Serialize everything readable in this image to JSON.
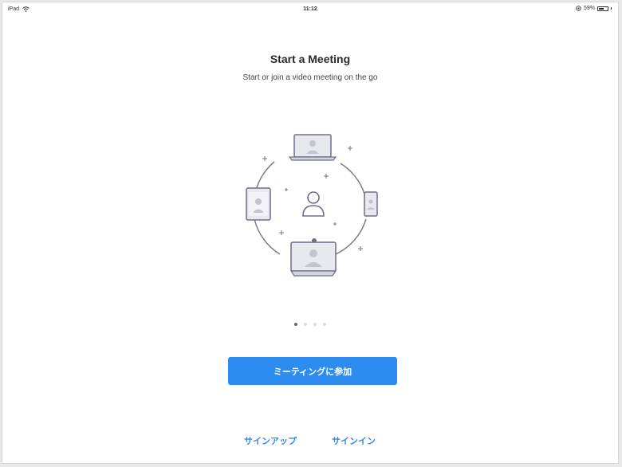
{
  "status_bar": {
    "device": "iPad",
    "time": "11:12",
    "battery_percent": "59%",
    "battery_level": 0.59,
    "icons": [
      "wifi-icon",
      "orientation-lock-icon",
      "battery-icon"
    ]
  },
  "onboarding": {
    "title": "Start a Meeting",
    "subtitle": "Start or join a video meeting on the go",
    "page_indicator": {
      "total": 4,
      "current": 1
    },
    "illustration_icon": "video-meeting-devices-icon"
  },
  "actions": {
    "join_meeting_label": "ミーティングに参加",
    "sign_up_label": "サインアップ",
    "sign_in_label": "サインイン"
  },
  "colors": {
    "accent": "#2d8cf0",
    "illustration_stroke": "#6e6e86",
    "illustration_fill": "#e6e6ee"
  }
}
